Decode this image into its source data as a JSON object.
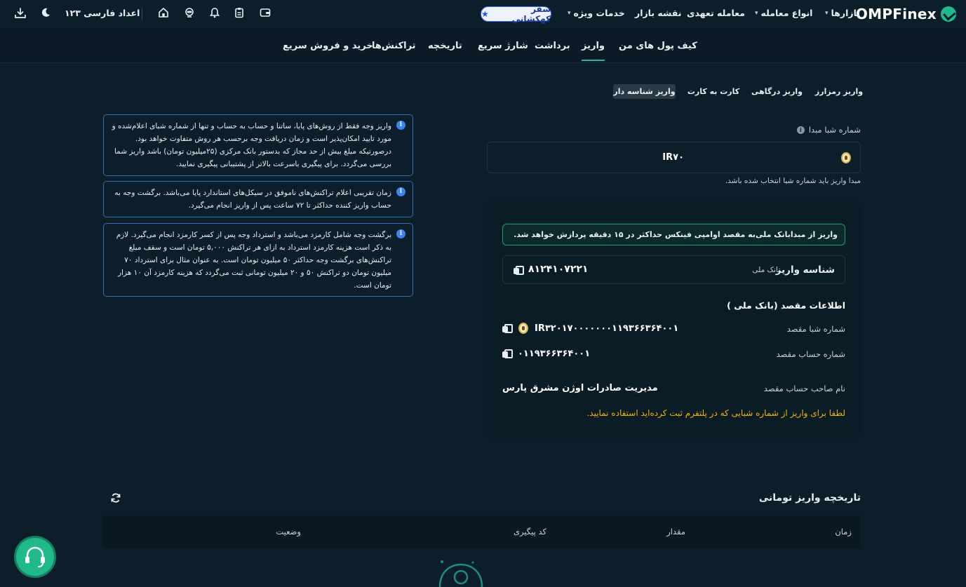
{
  "header": {
    "brand": "OMPFinex",
    "nav": [
      {
        "label": "بازارها",
        "dropdown": true
      },
      {
        "label": "انواع معامله",
        "dropdown": true
      },
      {
        "label": "معامله تعهدی",
        "dropdown": false
      },
      {
        "label": "نقشه بازار",
        "dropdown": false
      },
      {
        "label": "خدمات ویژه",
        "dropdown": true
      }
    ],
    "promo_badge": "سفر کهکشانی",
    "language_toggle": "اعداد فارسی ۱۲۳",
    "icons": [
      "wallet-icon",
      "clipboard-icon",
      "bell-icon",
      "support-agent-icon",
      "home-icon",
      "moon-icon",
      "download-icon"
    ]
  },
  "subnav": {
    "items": [
      {
        "label": "کیف پول های من",
        "active": false
      },
      {
        "label": "واریز",
        "active": true
      },
      {
        "label": "برداشت",
        "active": false
      },
      {
        "label": "شارژ سریع",
        "active": false
      },
      {
        "label": "تاریخچه",
        "active": false
      },
      {
        "label": "تراکنش‌ها",
        "active": false
      },
      {
        "label": "خرید و فروش سریع",
        "active": false
      }
    ]
  },
  "deposit_tabs": [
    {
      "label": "واریز رمزارز",
      "active": false
    },
    {
      "label": "واریز درگاهی",
      "active": false
    },
    {
      "label": "کارت به کارت",
      "active": false
    },
    {
      "label": "واریز شناسه دار",
      "active": true
    }
  ],
  "info_notes": [
    "واریز وجه فقط از روش‌های پایا، ساتنا و حساب به حساب و تنها از شماره شبای اعلام‌شده و مورد تایید امکان‌پذیر است و زمان دریافت وجه برحسب هر روش متفاوت خواهد بود. درصورتیکه مبلغ بیش از حد مجاز که بدستور بانک مرکزی (۲۵میلیون تومان) باشد واریز شما بررسی می‌گردد. برای پیگیری باسرعت بالاتر از پشتیبانی پیگیری نمایید.",
    "زمان تقریبی اعلام تراکنش‌های ناموفق در سیکل‌های استاندارد پایا می‌باشد. برگشت وجه به حساب واریز کننده حداکثر تا ۷۲ ساعت پس از واریز انجام می‌گیرد.",
    "برگشت وجه شامل کارمزد می‌باشد و استرداد وجه پس از کسر کارمزد انجام می‌گیرد. لازم به ذکر است هزینه کارمزد استرداد به ازای هر تراکنش ۵,۰۰۰ تومان است و سقف مبلغ تراکنش‌های برگشت وجه حداکثر ۵۰ میلیون تومان است. به عنوان مثال برای استرداد ۷۰ میلیون تومان دو تراکنش ۵۰ و ۲۰ میلیون تومانی ثبت می‌گردد که هزینه کارمزد آن ۱۰ هزار تومان است."
  ],
  "source": {
    "label": "شماره شبا مبدا",
    "value": "IR۷۰",
    "hint": "مبدا واریز باید شماره شبا انتخاب شده باشد."
  },
  "panel": {
    "notice": "واریز از مبدا‌بانک ملی‌به مقصد اوامپی فینکس حداکثر در ۱۵ دقیقه پردازش خواهد شد.",
    "deposit_id_label": "شناسه واریز",
    "bank_name": "بانک ملی",
    "deposit_id": "۸۱۲۴۱۰۷۲۲۱",
    "dest_title": "اطلاعات مقصد (بانک ملی )",
    "dest_iban_label": "شماره شبا مقصد",
    "dest_iban": "IR۳۲۰۱۷۰۰۰۰۰۰۰۱۱۹۳۶۶۳۶۴۰۰۱",
    "dest_account_label": "شماره حساب مقصد",
    "dest_account": "۰۱۱۹۳۶۶۳۶۴۰۰۱",
    "owner_label": "نام صاحب حساب مقصد",
    "owner": "مدیریت صادرات اوژن مشرق پارس",
    "warning": "لطفا برای واریز از شماره شبایی که در پلتفرم ثبت کرده‌اید استفاده نمایید."
  },
  "history": {
    "title": "تاریخچه واریز تومانی",
    "columns": [
      "زمان",
      "مقدار",
      "کد پیگیری",
      "وضعیت"
    ]
  },
  "colors": {
    "background": "#0d1e2b",
    "accent": "#1fb98a",
    "info_border": "#2e6fb6",
    "warning": "#f5b400"
  }
}
